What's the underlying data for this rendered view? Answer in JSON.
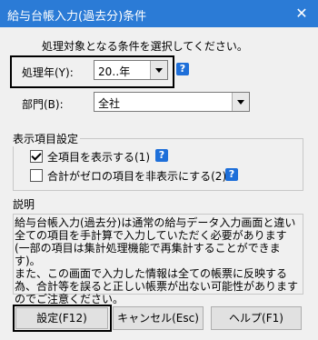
{
  "window": {
    "title": "給与台帳入力(過去分)条件",
    "close_glyph": "✕"
  },
  "instruction": "処理対象となる条件を選択してください。",
  "year": {
    "label": "処理年(Y):",
    "value": "20‥年",
    "help": "?"
  },
  "department": {
    "label": "部門(B):",
    "value": "全社"
  },
  "display_settings": {
    "title": "表示項目設定",
    "show_all": {
      "label": "全項目を表示する(1)",
      "checked": true,
      "help": "?"
    },
    "hide_zero": {
      "label": "合計がゼロの項目を非表示にする(2)",
      "checked": false,
      "help": "?"
    }
  },
  "description": {
    "title": "説明",
    "text": "給与台帳入力(過去分)は通常の給与データ入力画面と違い全ての項目を手計算で入力していただく必要があります(一部の項目は集計処理機能で再集計することができます)。\nまた、この画面で入力した情報は全ての帳票に反映する為、合計等を誤ると正しい帳票が出ない可能性がありますのでご注意ください。"
  },
  "buttons": {
    "ok": "設定(F12)",
    "cancel": "キャンセル(Esc)",
    "help": "ヘルプ(F1)"
  }
}
